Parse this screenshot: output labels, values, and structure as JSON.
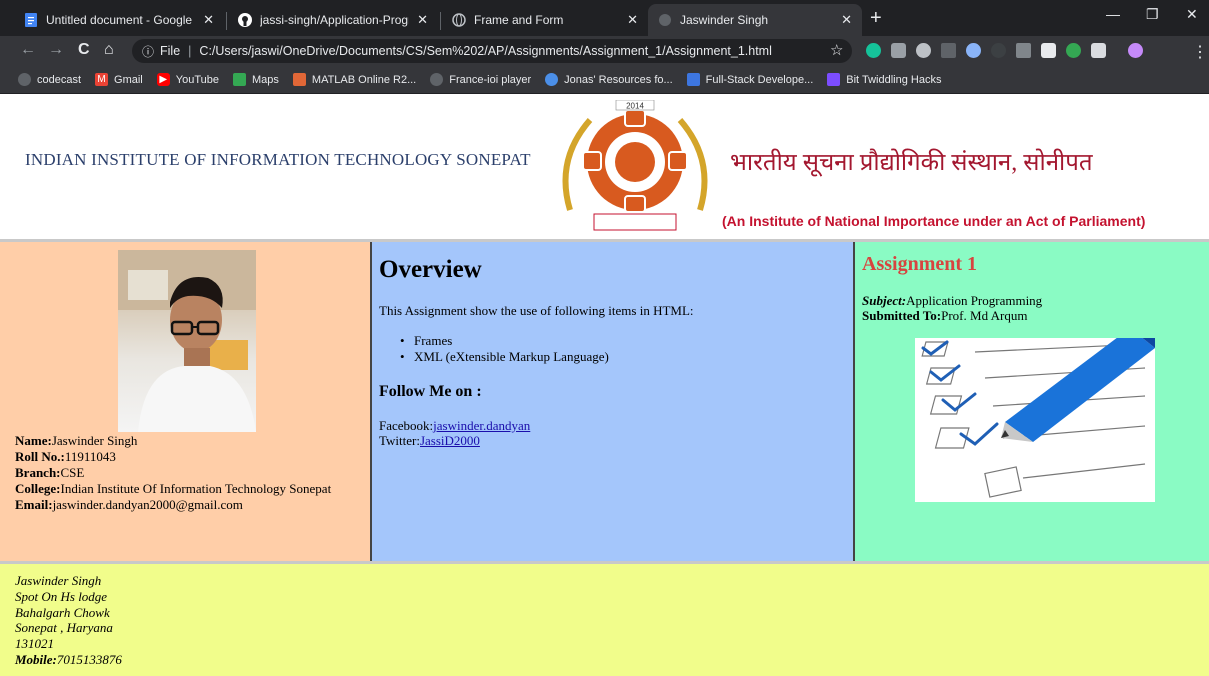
{
  "browser": {
    "tabs": [
      {
        "title": "Untitled document - Google Doc",
        "icon": "docs-icon"
      },
      {
        "title": "jassi-singh/Application-Programm",
        "icon": "github-icon"
      },
      {
        "title": "Frame and Form",
        "icon": "globe-icon"
      },
      {
        "title": "Jaswinder Singh",
        "icon": "globe-icon"
      }
    ],
    "url_prefix": "File",
    "url": "C:/Users/jaswi/OneDrive/Documents/CS/Sem%202/AP/Assignments/Assignment_1/Assignment_1.html",
    "bookmarks": [
      {
        "label": "codecast",
        "color": "#5f6368"
      },
      {
        "label": "Gmail",
        "color": "#ea4335"
      },
      {
        "label": "YouTube",
        "color": "#ff0000"
      },
      {
        "label": "Maps",
        "color": "#34a853"
      },
      {
        "label": "MATLAB Online R2...",
        "color": "#e16737"
      },
      {
        "label": "France-ioi player",
        "color": "#5f6368"
      },
      {
        "label": "Jonas' Resources fo...",
        "color": "#4b8fe8"
      },
      {
        "label": "Full-Stack Develope...",
        "color": "#3d76e0"
      },
      {
        "label": "Bit Twiddling Hacks",
        "color": "#7c4dff"
      }
    ]
  },
  "banner": {
    "english_name": "INDIAN INSTITUTE OF INFORMATION TECHNOLOGY SONEPAT",
    "hindi_name": "भारतीय सूचना प्रौद्योगिकी संस्थान, सोनीपत",
    "subtitle": "(An Institute of National Importance under an Act of Parliament)",
    "logo_year": "2014"
  },
  "profile": {
    "name_label": "Name:",
    "name": "Jaswinder Singh",
    "roll_label": "Roll No.:",
    "roll": "11911043",
    "branch_label": "Branch:",
    "branch": "CSE",
    "college_label": "College:",
    "college": "Indian Institute Of Information Technology Sonepat",
    "email_label": "Email:",
    "email": "jaswinder.dandyan2000@gmail.com"
  },
  "overview": {
    "title": "Overview",
    "description": "This Assignment show the use of following items in HTML:",
    "items": [
      "Frames",
      "XML (eXtensible Markup Language)"
    ],
    "follow_title": "Follow Me on :",
    "facebook_label": "Facebook:",
    "facebook_link": "jaswinder.dandyan",
    "twitter_label": "Twitter:",
    "twitter_link": "JassiD2000"
  },
  "assignment": {
    "title": "Assignment 1",
    "subject_label": "Subject:",
    "subject": "Application Programming",
    "submitted_label": "Submitted To:",
    "submitted_to": "Prof. Md Arqum"
  },
  "footer": {
    "lines": [
      "Jaswinder Singh",
      "Spot On Hs lodge",
      "Bahalgarh Chowk",
      "Sonepat , Haryana",
      "131021"
    ],
    "mobile_label": "Mobile:",
    "mobile": "7015133876"
  },
  "colors": {
    "left_frame": "#ffcea8",
    "middle_frame": "#a4c6fb",
    "right_frame": "#8afbc4",
    "footer": "#f1fd8b",
    "assignment_title": "#d7443f"
  }
}
